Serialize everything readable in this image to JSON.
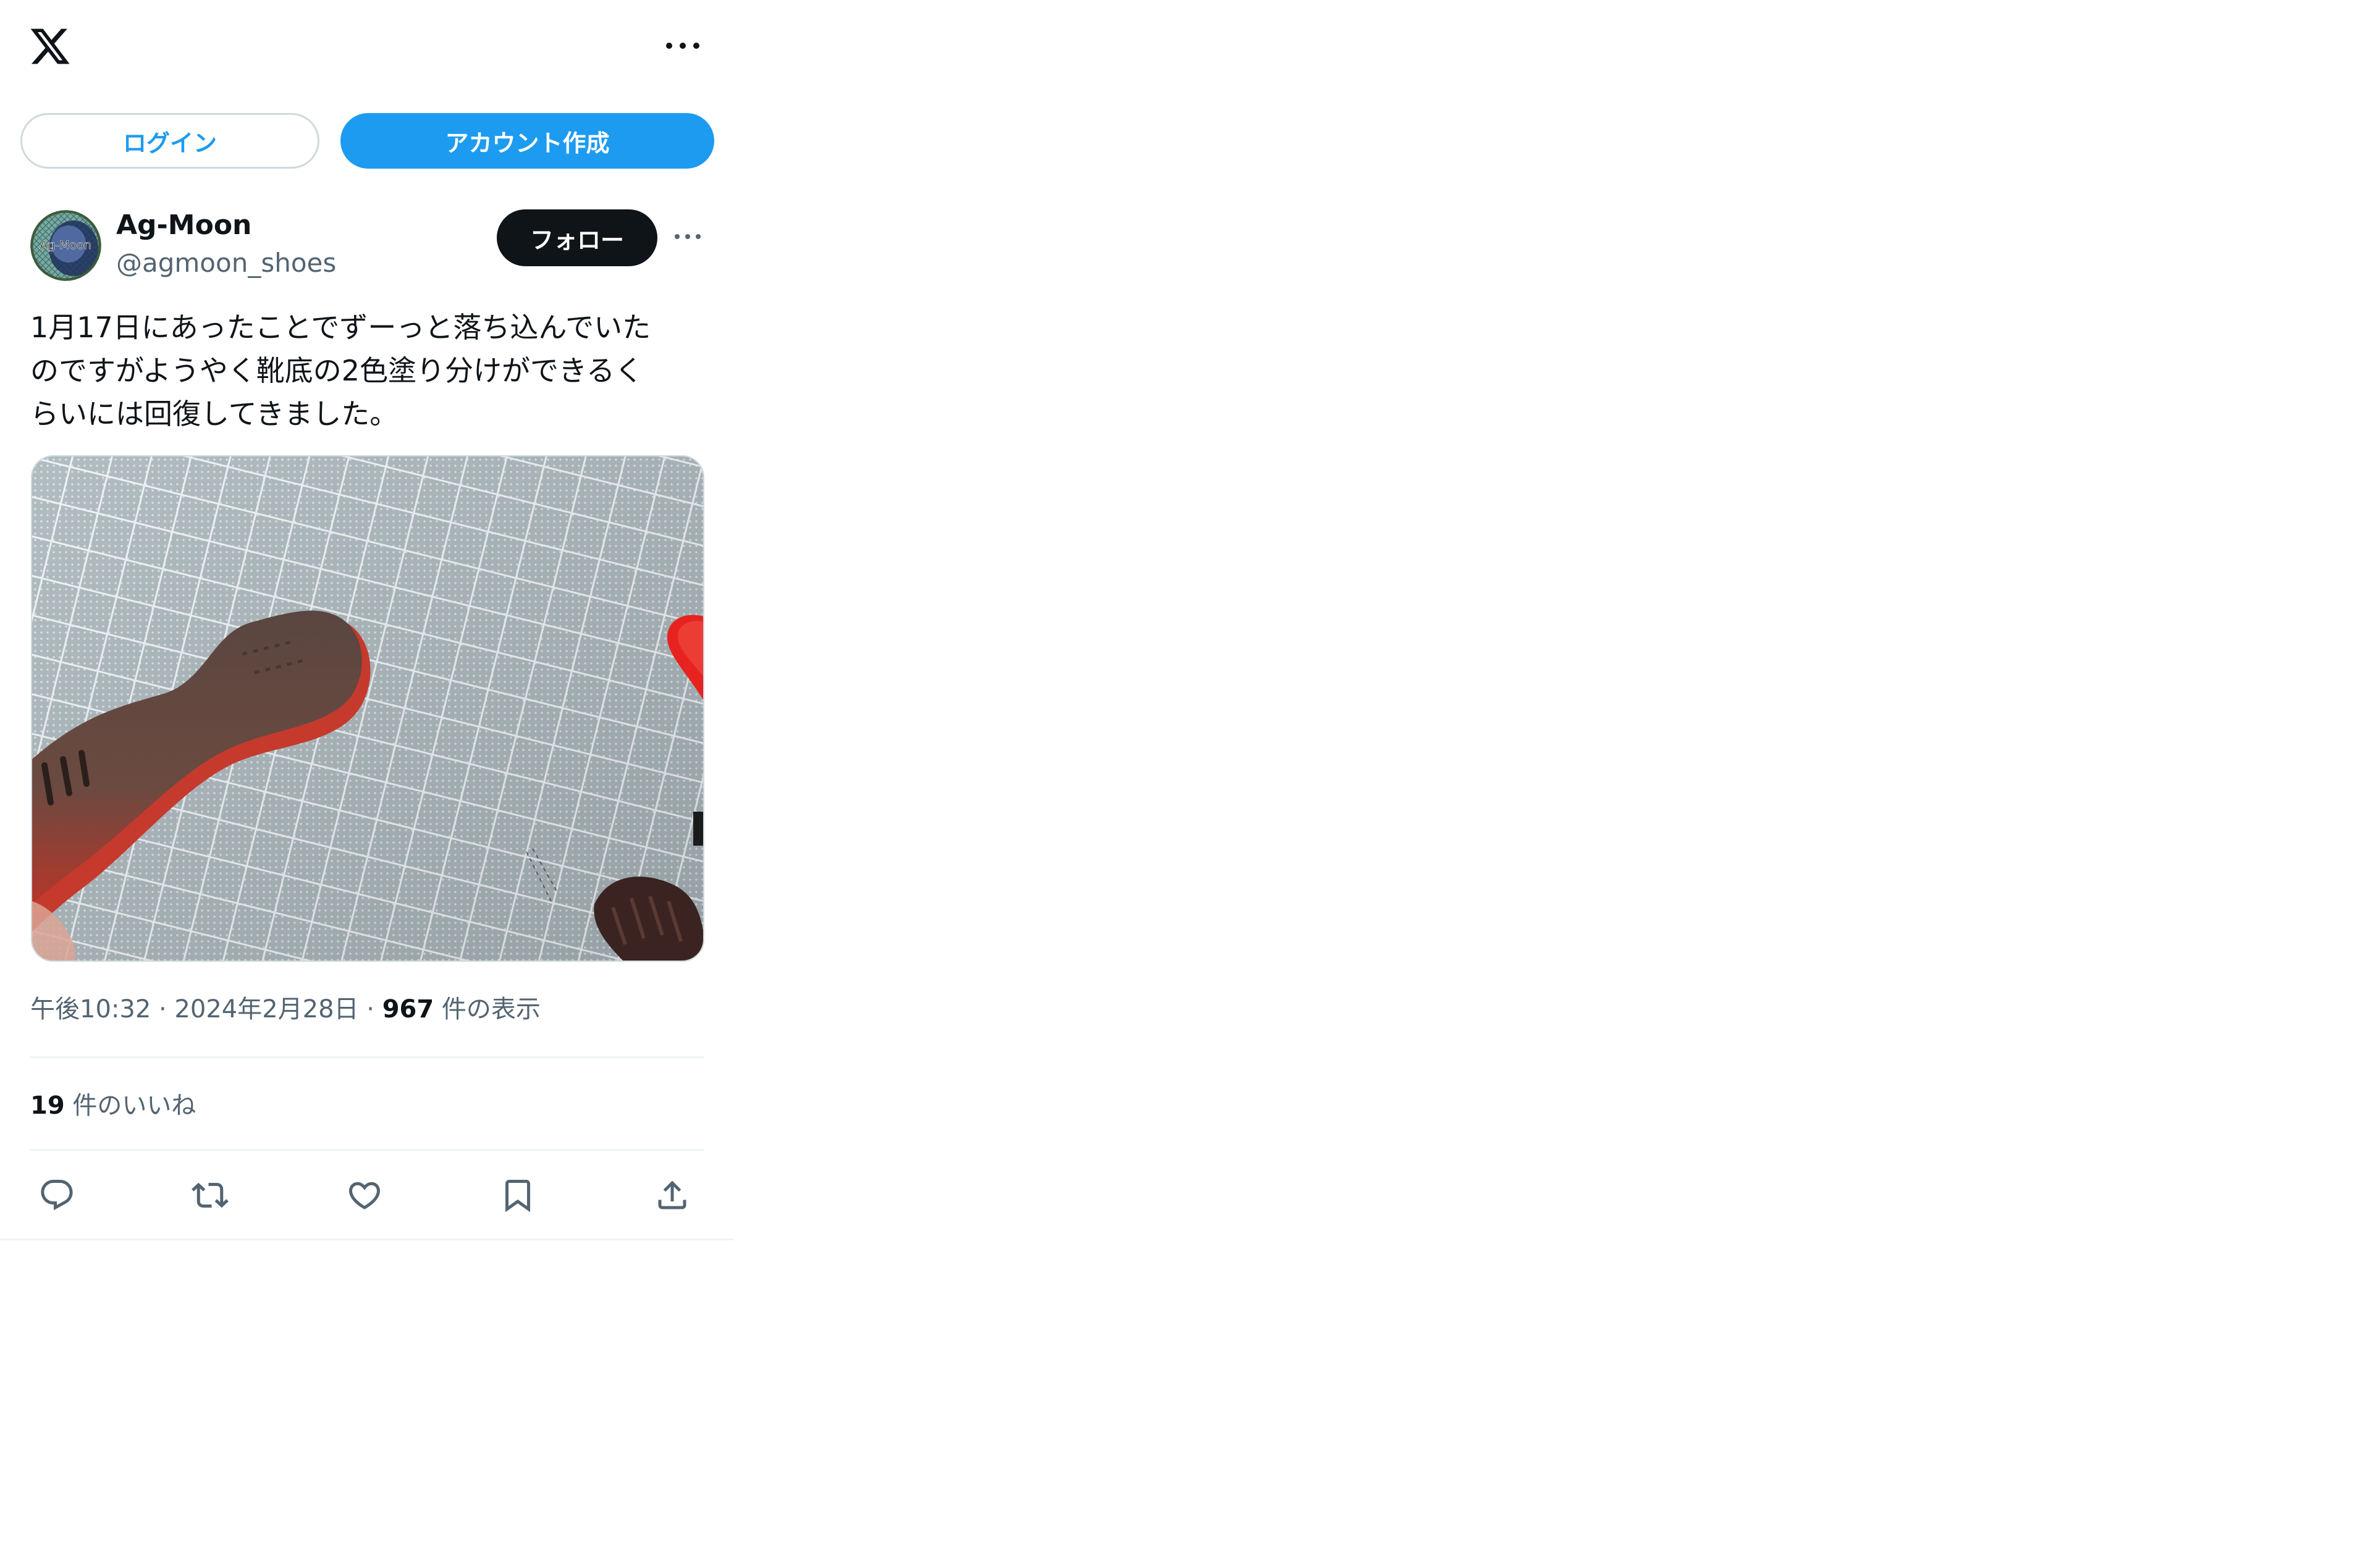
{
  "header": {
    "logo_icon": "x-logo-icon",
    "more_icon": "more-horizontal-icon"
  },
  "auth": {
    "login_label": "ログイン",
    "signup_label": "アカウント作成"
  },
  "tweet": {
    "author": {
      "display_name": "Ag-Moon",
      "handle": "@agmoon_shoes",
      "avatar_text": "Ag-Moon"
    },
    "follow_label": "フォロー",
    "text_lines": [
      "1月17日にあったことでずーっと落ち込んでいた",
      "のですがようやく靴底の2色塗り分けができるく",
      "らいには回復してきました。"
    ],
    "timestamp": "午後10:32 · 2024年2月28日",
    "separator": " · ",
    "view_count": "967",
    "view_label": " 件の表示",
    "like_count": "19",
    "like_label": " 件のいいね",
    "actions": [
      "reply-icon",
      "retweet-icon",
      "like-icon",
      "bookmark-icon",
      "share-icon"
    ]
  },
  "colors": {
    "accent": "#1d9bf0",
    "text_primary": "#0f1419",
    "text_secondary": "#536471",
    "border": "#cfd9de"
  }
}
